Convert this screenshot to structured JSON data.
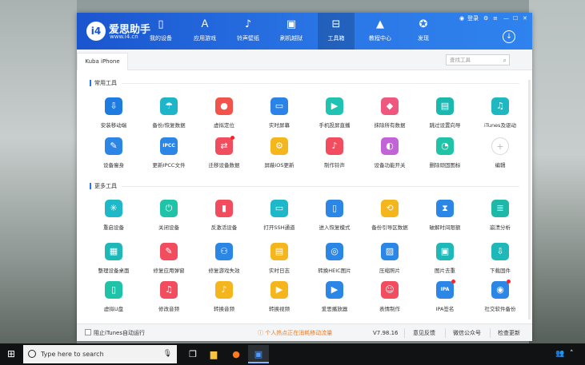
{
  "window": {
    "logo_badge": "i4",
    "logo_name": "爱思助手",
    "logo_url": "www.i4.cn",
    "top_controls": {
      "login": "登录"
    },
    "nav": [
      {
        "label": "我的设备",
        "icon": "phone-icon"
      },
      {
        "label": "应用游戏",
        "icon": "appstore-icon"
      },
      {
        "label": "铃声壁纸",
        "icon": "music-icon"
      },
      {
        "label": "刷机越狱",
        "icon": "box-icon"
      },
      {
        "label": "工具箱",
        "icon": "toolbox-icon",
        "active": true
      },
      {
        "label": "教程中心",
        "icon": "graduation-icon"
      },
      {
        "label": "发现",
        "icon": "compass-icon"
      }
    ]
  },
  "device_bar": {
    "device_tab": "Kuba iPhone",
    "search_placeholder": "查找工具"
  },
  "sections": [
    {
      "title": "常用工具",
      "tools": [
        {
          "label": "安装移动端",
          "color": "#1e7be0",
          "glyph": "⇩"
        },
        {
          "label": "备份/恢复数据",
          "color": "#1fb5c8",
          "glyph": "☂"
        },
        {
          "label": "虚拟定位",
          "color": "#f2544c",
          "glyph": "●"
        },
        {
          "label": "实时屏幕",
          "color": "#2b83e8",
          "glyph": "▭"
        },
        {
          "label": "手机投屏直播",
          "color": "#20c2b2",
          "glyph": "▶"
        },
        {
          "label": "抹除所有数据",
          "color": "#f0577e",
          "glyph": "◆"
        },
        {
          "label": "跳过设置向导",
          "color": "#1bb8b0",
          "glyph": "▤"
        },
        {
          "label": "iTunes及驱动",
          "color": "#1fb8c0",
          "glyph": "♫"
        },
        {
          "label": "设备瘦身",
          "color": "#2b86e6",
          "glyph": "✎"
        },
        {
          "label": "更新IPCC文件",
          "color": "#2b86e6",
          "glyph": "IPCC"
        },
        {
          "label": "迁移设备数据",
          "color": "#f24d5f",
          "glyph": "⇄",
          "dot": true
        },
        {
          "label": "屏蔽iOS更新",
          "color": "#f5b51c",
          "glyph": "⚙"
        },
        {
          "label": "制作铃声",
          "color": "#f24d5f",
          "glyph": "♪"
        },
        {
          "label": "设备功能开关",
          "color": "#c263d8",
          "glyph": "◐"
        },
        {
          "label": "删除顽固图标",
          "color": "#1fc3a8",
          "glyph": "◔"
        },
        {
          "label": "编辑",
          "color": "#ffffff",
          "glyph": "+",
          "plus": true
        }
      ]
    },
    {
      "title": "更多工具",
      "tools": [
        {
          "label": "重启设备",
          "color": "#1fb8c8",
          "glyph": "✳"
        },
        {
          "label": "关闭设备",
          "color": "#1fc3a8",
          "glyph": "⏻"
        },
        {
          "label": "反激活设备",
          "color": "#f24d5f",
          "glyph": "▮"
        },
        {
          "label": "打开SSH通道",
          "color": "#1fb8c8",
          "glyph": "▭"
        },
        {
          "label": "进入恢复模式",
          "color": "#2b86e6",
          "glyph": "▯"
        },
        {
          "label": "备份引导区数据",
          "color": "#f5b51c",
          "glyph": "⟲"
        },
        {
          "label": "破解时间限额",
          "color": "#2b86e6",
          "glyph": "⧗"
        },
        {
          "label": "崩溃分析",
          "color": "#1fb8a8",
          "glyph": "≣"
        },
        {
          "label": "整理设备桌面",
          "color": "#1fb8b8",
          "glyph": "▦"
        },
        {
          "label": "修复应用弹窗",
          "color": "#f24d5f",
          "glyph": "✎"
        },
        {
          "label": "修复游戏失效",
          "color": "#2b86e6",
          "glyph": "⚇"
        },
        {
          "label": "实时日志",
          "color": "#f5b51c",
          "glyph": "▤"
        },
        {
          "label": "转换HEIC图片",
          "color": "#2b86e6",
          "glyph": "◎"
        },
        {
          "label": "压缩照片",
          "color": "#2b86e6",
          "glyph": "▨"
        },
        {
          "label": "图片去重",
          "color": "#1fb8b8",
          "glyph": "▣"
        },
        {
          "label": "下载固件",
          "color": "#1fb8b8",
          "glyph": "⇩"
        },
        {
          "label": "虚拟U盘",
          "color": "#1fc3a8",
          "glyph": "▯"
        },
        {
          "label": "修改音频",
          "color": "#f24d5f",
          "glyph": "♫"
        },
        {
          "label": "转换音频",
          "color": "#f5b51c",
          "glyph": "♪"
        },
        {
          "label": "转换视频",
          "color": "#f5b51c",
          "glyph": "▶"
        },
        {
          "label": "爱思播放器",
          "color": "#2b86e6",
          "glyph": "▶"
        },
        {
          "label": "表情制作",
          "color": "#f24d5f",
          "glyph": "☺"
        },
        {
          "label": "IPA签名",
          "color": "#2b86e6",
          "glyph": "IPA",
          "dot": true
        },
        {
          "label": "社交软件备份",
          "color": "#2b86e6",
          "glyph": "◉",
          "dot": true
        }
      ]
    }
  ],
  "status_bar": {
    "block_itunes": "阻止iTunes自动运行",
    "warning": "个人热点正在消耗移动流量",
    "version": "V7.98.16",
    "feedback": "意见反馈",
    "wechat": "微信公众号",
    "check_update": "检查更新"
  },
  "taskbar": {
    "search_placeholder": "Type here to search"
  },
  "colors": {
    "header_start": "#1a55cf",
    "header_end": "#2f83ee",
    "warning": "#f07a1d"
  }
}
